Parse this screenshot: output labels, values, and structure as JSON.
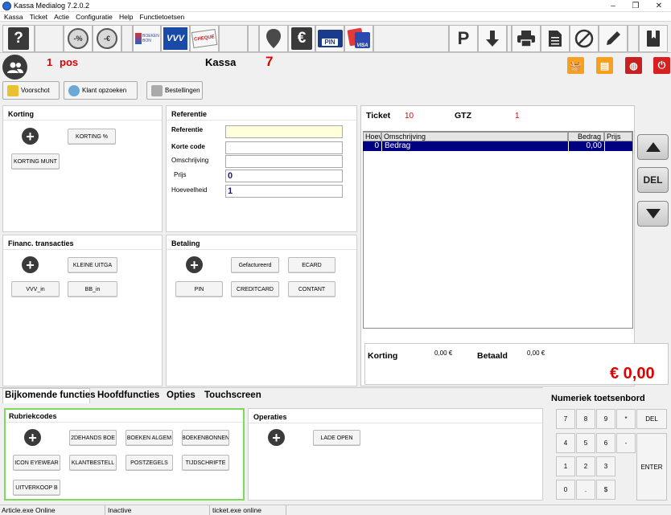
{
  "window": {
    "title": "Kassa Medialog 7.2.0.2",
    "minimize": "–",
    "maximize": "❐",
    "close": "✕"
  },
  "menu": [
    "Kassa",
    "Ticket",
    "Actie",
    "Configuratie",
    "Help",
    "Functietoetsen"
  ],
  "toolbar": {
    "help": "?",
    "discount_percent": "-%",
    "discount_euro": "-€",
    "boekenbon": "BOEKEN BON",
    "vvv": "VVV",
    "cheque": "CHEQUE",
    "euro": "€",
    "pin": "PIN",
    "visa": "VISA",
    "parking": "P"
  },
  "info": {
    "pos_number": "1",
    "pos_label": "pos",
    "kassa_label": "Kassa",
    "kassa_number": "7"
  },
  "actions": {
    "voorschot": "Voorschot",
    "klant_opzoeken": "Klant opzoeken",
    "bestellingen": "Bestellingen"
  },
  "korting": {
    "title": "Korting",
    "btn_percent": "KORTING %",
    "btn_munt": "KORTING MUNT"
  },
  "referentie": {
    "title": "Referentie",
    "fields": [
      {
        "label": "Referentie",
        "value": ""
      },
      {
        "label": "Korte code",
        "value": ""
      },
      {
        "label": "Omschrijving",
        "value": ""
      },
      {
        "label": "Prijs",
        "value": "0"
      },
      {
        "label": "Hoeveelheid",
        "value": "1"
      }
    ]
  },
  "financ": {
    "title": "Financ. transacties",
    "kleine_uitgaaf": "KLEINE UITGA",
    "vvv_in": "VVV_in",
    "bb_in": "BB_in"
  },
  "betaling": {
    "title": "Betaling",
    "gefactureerd": "Gefactureerd",
    "ecard": "ECARD",
    "pin": "PIN",
    "creditcard": "CREDITCARD",
    "contant": "CONTANT"
  },
  "ticket": {
    "label": "Ticket",
    "number": "10",
    "gtz_label": "GTZ",
    "gtz_value": "1",
    "columns": [
      "Hoev",
      "Omschrijving",
      "Bedrag",
      "Prijs"
    ],
    "rows": [
      {
        "qty": "0",
        "desc": "Bedrag",
        "amount": "0,00",
        "price": ""
      }
    ],
    "del": "DEL"
  },
  "totals": {
    "korting_label": "Korting",
    "korting_value": "0,00 €",
    "betaald_label": "Betaald",
    "betaald_value": "0,00 €",
    "total": "€ 0,00"
  },
  "tabs": [
    "Bijkomende functies",
    "Hoofdfuncties",
    "Opties",
    "Touchscreen"
  ],
  "rubriekcodes": {
    "title": "Rubriekcodes",
    "buttons": [
      "2DEHANDS BOE",
      "BOEKEN ALGEM",
      "BOEKENBONNEN",
      "ICON EYEWEAR",
      "KLANTBESTELL",
      "POSTZEGELS",
      "TIJDSCHRIFTE",
      "UITVERKOOP B"
    ]
  },
  "operaties": {
    "title": "Operaties",
    "lade_open": "LADE OPEN"
  },
  "keypad": {
    "title": "Numeriek toetsenbord",
    "keys": [
      "7",
      "8",
      "9",
      "*",
      "4",
      "5",
      "6",
      "-",
      "1",
      "2",
      "3",
      "0",
      ".",
      "$"
    ],
    "del": "DEL",
    "enter": "ENTER"
  },
  "status": [
    "Article.exe Online",
    "Inactive",
    "ticket.exe online"
  ],
  "colors": {
    "accent_red": "#e00000",
    "selection_blue": "#000080",
    "highlight_green": "#7cdc5a",
    "vvv_blue": "#1a4aa8",
    "dark_icon": "#3a3a3a"
  }
}
